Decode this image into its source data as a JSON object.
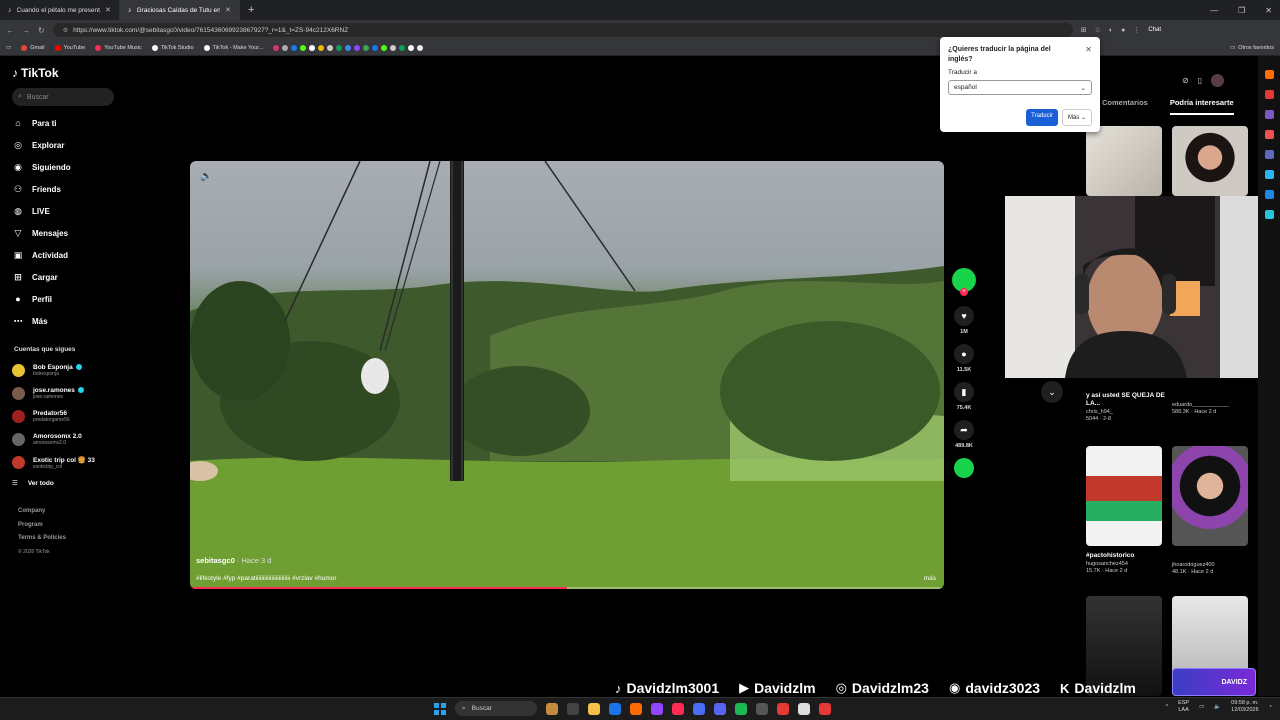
{
  "browser": {
    "tabs": [
      {
        "title": "Cuando el pétalo me presenta a s",
        "active": false
      },
      {
        "title": "Graciosas Caídas de Tutu en",
        "active": true
      }
    ],
    "url": "https://www.tiktok.com/@sebitasgc0/video/7615436069923867927?_r=1&_t=ZS-94c212X6RNZ",
    "chat_label": "Chat",
    "bookmarks": [
      "Gmail",
      "YouTube",
      "YouTube Music",
      "TikTok Studio",
      "TikTok - Make Your..."
    ],
    "bookmarks_other": "Otros favoritos"
  },
  "sidebar": {
    "logo": "TikTok",
    "search_placeholder": "Buscar",
    "nav": [
      {
        "label": "Para ti",
        "icon": "home-icon"
      },
      {
        "label": "Explorar",
        "icon": "compass-icon"
      },
      {
        "label": "Siguiendo",
        "icon": "following-icon"
      },
      {
        "label": "Friends",
        "icon": "friends-icon"
      },
      {
        "label": "LIVE",
        "icon": "live-icon"
      },
      {
        "label": "Mensajes",
        "icon": "messages-icon"
      },
      {
        "label": "Actividad",
        "icon": "activity-icon"
      },
      {
        "label": "Cargar",
        "icon": "upload-icon"
      },
      {
        "label": "Perfil",
        "icon": "profile-icon"
      },
      {
        "label": "Más",
        "icon": "more-icon"
      }
    ],
    "following_title": "Cuentas que sigues",
    "following": [
      {
        "name": "Bob Esponja",
        "handle": "bobesponja",
        "verified": true,
        "color": "#e7c235"
      },
      {
        "name": "jose.ramones",
        "handle": "jose.ramones",
        "verified": true,
        "color": "#7a5a4a"
      },
      {
        "name": "Predator56",
        "handle": "predatorgame56",
        "verified": false,
        "color": "#a02020"
      },
      {
        "name": "Amorosomx 2.0",
        "handle": "amorosomx2.0",
        "verified": false,
        "color": "#666666"
      },
      {
        "name": "Exotic trip col 🍔 33",
        "handle": "exotictrip_col",
        "verified": false,
        "color": "#c0392b"
      }
    ],
    "see_all": "Ver todo",
    "footer": [
      "Company",
      "Program",
      "Terms & Policies"
    ],
    "copyright": "© 2026 TikTok"
  },
  "video": {
    "author": "sebitasgc0",
    "ago": " · Hace 3 d",
    "tags": "#lifestyle #fyp #paratiiiiiiiiiiiiiiiiiiiiiiii #vrzlav #humor",
    "more": "más",
    "progress": 0.5
  },
  "rail": {
    "likes": "1M",
    "comments": "11.5K",
    "saves": "75.4K",
    "shares": "489.8K"
  },
  "right_panel": {
    "tabs": [
      "Comentarios",
      "Podría interesarte"
    ],
    "items": [
      {
        "title": "y así usted SE QUEJA DE LA...",
        "user": "chris_h94_",
        "stats": "5044 · 2-8"
      },
      {
        "title": "",
        "user": "eduardo____________",
        "stats": "588.3K · Hace 2 d"
      },
      {
        "title": "#pactohistorico",
        "user": "hugosanchez454",
        "stats": "15.7K · Hace 2 d"
      },
      {
        "title": "",
        "user": "jhoarodriguez400",
        "stats": "48.1K · Hace 2 d"
      }
    ]
  },
  "translate": {
    "question": "¿Quieres traducir la página del inglés?",
    "label": "Traducir a",
    "selected": "español",
    "primary": "Traducir",
    "more": "Más"
  },
  "socials": [
    {
      "icon": "tiktok-icon",
      "glyph": "♪",
      "handle": "Davidzlm3001"
    },
    {
      "icon": "youtube-icon",
      "glyph": "▶",
      "handle": "Davidzlm"
    },
    {
      "icon": "instagram-icon",
      "glyph": "◎",
      "handle": "Davidzlm23"
    },
    {
      "icon": "discord-icon",
      "glyph": "◉",
      "handle": "davidz3023"
    },
    {
      "icon": "kick-icon",
      "glyph": "K",
      "handle": "Davidzlm"
    }
  ],
  "badge_text": "DAVIDZ",
  "taskbar": {
    "search_placeholder": "Buscar",
    "lang_top": "ESP",
    "lang_bottom": "LAA",
    "time": "09:58 p. m.",
    "date": "12/03/2026"
  }
}
